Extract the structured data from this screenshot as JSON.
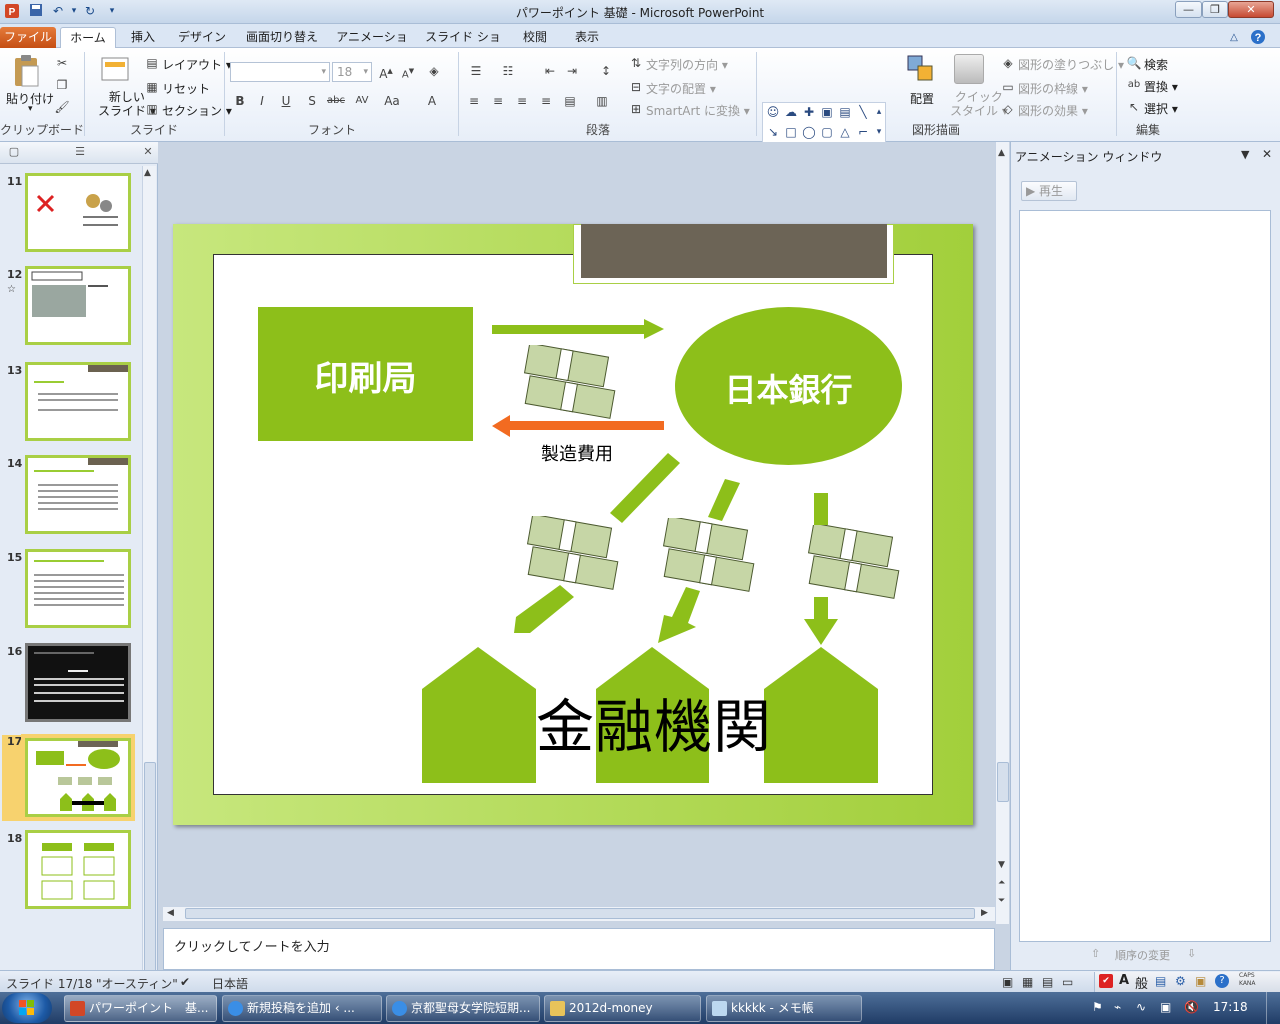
{
  "window": {
    "title": "パワーポイント 基礎 - Microsoft PowerPoint"
  },
  "tabs": [
    {
      "label": "ファイル"
    },
    {
      "label": "ホーム"
    },
    {
      "label": "挿入"
    },
    {
      "label": "デザイン"
    },
    {
      "label": "画面切り替え"
    },
    {
      "label": "アニメーション"
    },
    {
      "label": "スライド ショー"
    },
    {
      "label": "校閲"
    },
    {
      "label": "表示"
    }
  ],
  "ribbon": {
    "clipboard": {
      "paste": "貼り付け",
      "label": "クリップボード"
    },
    "slides": {
      "new_slide": "新しい\nスライド",
      "new_slide_1": "新しい",
      "new_slide_2": "スライド",
      "layout": "レイアウト",
      "reset": "リセット",
      "section": "セクション",
      "label": "スライド"
    },
    "font": {
      "size": "18",
      "label": "フォント"
    },
    "paragraph": {
      "text_direction": "文字列の方向",
      "align_text": "文字の配置",
      "smartart": "SmartArt に変換",
      "label": "段落"
    },
    "drawing": {
      "arrange": "配置",
      "quick_styles_1": "クイック",
      "quick_styles_2": "スタイル",
      "shape_fill": "図形の塗りつぶし",
      "shape_outline": "図形の枠線",
      "shape_effects": "図形の効果",
      "label": "図形描画"
    },
    "editing": {
      "find": "検索",
      "replace": "置換",
      "select": "選択",
      "label": "編集"
    }
  },
  "slides_pane": {
    "thumbnails": [
      {
        "number": "11"
      },
      {
        "number": "12"
      },
      {
        "number": "13"
      },
      {
        "number": "14"
      },
      {
        "number": "15"
      },
      {
        "number": "16"
      },
      {
        "number": "17"
      },
      {
        "number": "18"
      }
    ]
  },
  "slide": {
    "printing_bureau": "印刷局",
    "bank_of_japan": "日本銀行",
    "manufacturing_cost": "製造費用",
    "financial_institutions": "金融機関"
  },
  "notes": {
    "placeholder": "クリックしてノートを入力"
  },
  "animation_pane": {
    "title": "アニメーション ウィンドウ",
    "play": "再生",
    "reorder": "順序の変更"
  },
  "status": {
    "slide": "スライド 17/18",
    "theme": "\"オースティン\"",
    "language": "日本語"
  },
  "taskbar": {
    "items": [
      {
        "label": "パワーポイント　基..."
      },
      {
        "label": "新規投稿を追加 ‹ ..."
      },
      {
        "label": "京都聖母女学院短期..."
      },
      {
        "label": "2012d-money"
      },
      {
        "label": "kkkkk - メモ帳"
      }
    ],
    "clock": "17:18"
  },
  "colors": {
    "slide_green": "#8dbf1a",
    "arrow_orange": "#f26b21",
    "file_tab": "#d35b1f"
  }
}
